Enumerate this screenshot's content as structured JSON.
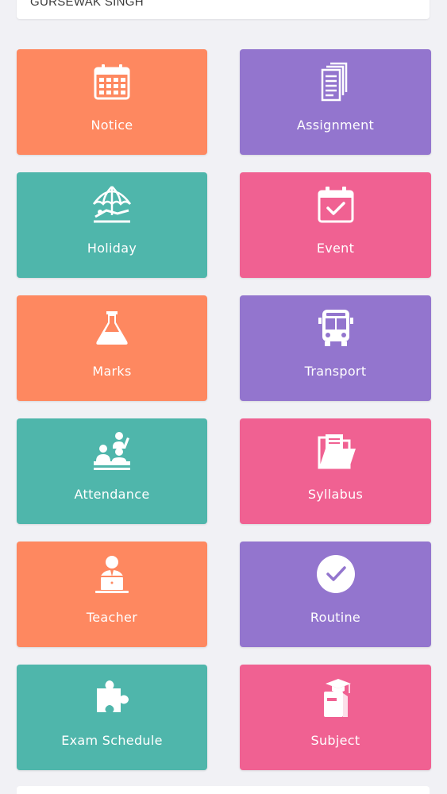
{
  "user": {
    "name": "GURSEWAK SINGH"
  },
  "colors": {
    "background": "#f1f1f5",
    "orange": "#fe8860",
    "purple": "#9375ce",
    "teal": "#4fb6ab",
    "pink": "#f06192"
  },
  "tiles": [
    {
      "label": "Notice",
      "icon": "calendar-icon"
    },
    {
      "label": "Assignment",
      "icon": "documents-icon"
    },
    {
      "label": "Holiday",
      "icon": "beach-umbrella-icon"
    },
    {
      "label": "Event",
      "icon": "calendar-check-icon"
    },
    {
      "label": "Marks",
      "icon": "flask-icon"
    },
    {
      "label": "Transport",
      "icon": "bus-icon"
    },
    {
      "label": "Attendance",
      "icon": "classroom-icon"
    },
    {
      "label": "Syllabus",
      "icon": "folder-icon"
    },
    {
      "label": "Teacher",
      "icon": "teacher-laptop-icon"
    },
    {
      "label": "Routine",
      "icon": "check-circle-icon"
    },
    {
      "label": "Exam Schedule",
      "icon": "puzzle-icon"
    },
    {
      "label": "Subject",
      "icon": "graduation-book-icon"
    }
  ]
}
